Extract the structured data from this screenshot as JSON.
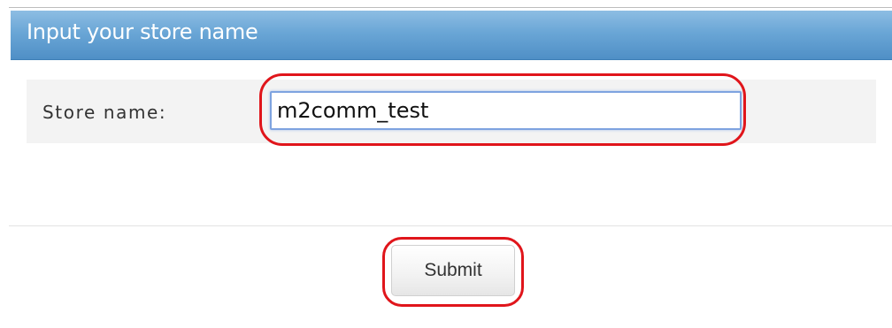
{
  "panel": {
    "title": "Input your store name"
  },
  "form": {
    "store_name_label": "Store name:",
    "store_name_value": "m2comm_test"
  },
  "actions": {
    "submit_label": "Submit"
  },
  "colors": {
    "header_blue": "#6aa6d6",
    "highlight_red": "#e0151b",
    "input_focus_border": "#7ea3e0"
  }
}
